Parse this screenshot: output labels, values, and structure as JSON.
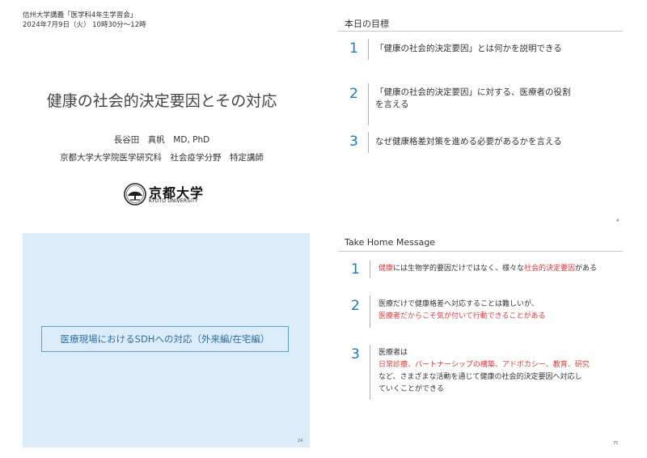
{
  "slide1": {
    "header_line1": "信州大学講義「医学科4年生学習会」",
    "header_line2": "2024年7月9日（火） 10時30分～12時",
    "title": "健康の社会的決定要因とその対応",
    "name": "長谷田　真帆　MD, PhD",
    "affiliation": "京都大学大学院医学研究科　社会疫学分野　特定講師",
    "logo_ja": "京都大学",
    "logo_en": "KYOTO UNIVERSITY"
  },
  "slide2": {
    "title": "本日の目標",
    "items": [
      {
        "num": "1",
        "text": "「健康の社会的決定要因」とは何かを説明できる"
      },
      {
        "num": "2",
        "text_line1": "「健康の社会的決定要因」に対する、医療者の役割",
        "text_line2": "を言える"
      },
      {
        "num": "3",
        "text": "なぜ健康格差対策を進める必要があるかを言える"
      }
    ],
    "page": "4"
  },
  "slide3": {
    "box_text": "医療現場におけるSDHへの対応（外来編/在宅編）",
    "page": "24",
    "colors": {
      "panel": "#dcecf8",
      "border": "#5a9fd0",
      "text": "#2c6fa8"
    }
  },
  "slide4": {
    "title": "Take Home Message",
    "item1": {
      "num": "1",
      "red1": "健康",
      "plain1": "には生物学的要因だけではなく、様々な",
      "red2": "社会的決定要因",
      "plain2": "がある"
    },
    "item2": {
      "num": "2",
      "line1": "医療だけで健康格差へ対応することは難しいが、",
      "line2_red": "医療者だからこそ気が付いて行動できることがある"
    },
    "item3": {
      "num": "3",
      "line1": "医療者は",
      "line2_red": "日常診療、パートナーシップの構築、アドボカシー、教育、研究",
      "line3": "など、さまざまな活動を通じて健康の社会的決定要因へ対応し",
      "line4": "ていくことができる"
    },
    "page": "75"
  },
  "colors": {
    "accent_blue": "#1c7ab8",
    "highlight_red": "#e23a3a"
  }
}
